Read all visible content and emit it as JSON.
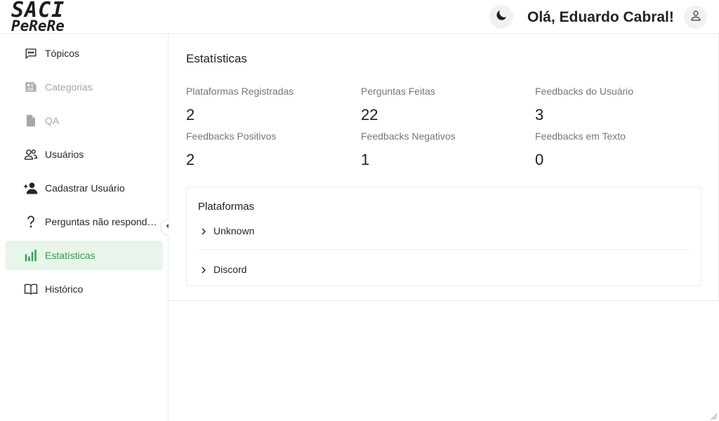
{
  "header": {
    "logo_line1": "SACI",
    "logo_line2": "PeReRe",
    "greeting": "Olá, Eduardo Cabral!",
    "theme_icon": "moon-icon",
    "user_icon": "user-icon"
  },
  "sidebar": {
    "items": [
      {
        "label": "Tópicos",
        "icon": "chat-bubble-icon",
        "state": "normal"
      },
      {
        "label": "Categorias",
        "icon": "newspaper-icon",
        "state": "disabled"
      },
      {
        "label": "QA",
        "icon": "document-icon",
        "state": "disabled"
      },
      {
        "label": "Usuários",
        "icon": "users-icon",
        "state": "normal"
      },
      {
        "label": "Cadastrar Usuário",
        "icon": "user-add-icon",
        "state": "normal"
      },
      {
        "label": "Perguntas não respondidas",
        "icon": "question-mark-icon",
        "state": "normal"
      },
      {
        "label": "Estatísticas",
        "icon": "bar-chart-icon",
        "state": "active"
      },
      {
        "label": "Histórico",
        "icon": "book-icon",
        "state": "normal"
      }
    ],
    "collapse_icon": "chevron-left-icon"
  },
  "main": {
    "title": "Estatísticas",
    "stats": [
      {
        "label": "Plataformas Registradas",
        "value": "2"
      },
      {
        "label": "Perguntas Feitas",
        "value": "22"
      },
      {
        "label": "Feedbacks do Usuário",
        "value": "3"
      },
      {
        "label": "Feedbacks Positivos",
        "value": "2"
      },
      {
        "label": "Feedbacks Negativos",
        "value": "1"
      },
      {
        "label": "Feedbacks em Texto",
        "value": "0"
      }
    ],
    "platforms": {
      "title": "Plataformas",
      "items": [
        "Unknown",
        "Discord"
      ]
    }
  },
  "colors": {
    "accent": "#2f9e52",
    "active_bg": "#e8f5ea",
    "border": "#ececec",
    "muted_text": "#767676"
  }
}
